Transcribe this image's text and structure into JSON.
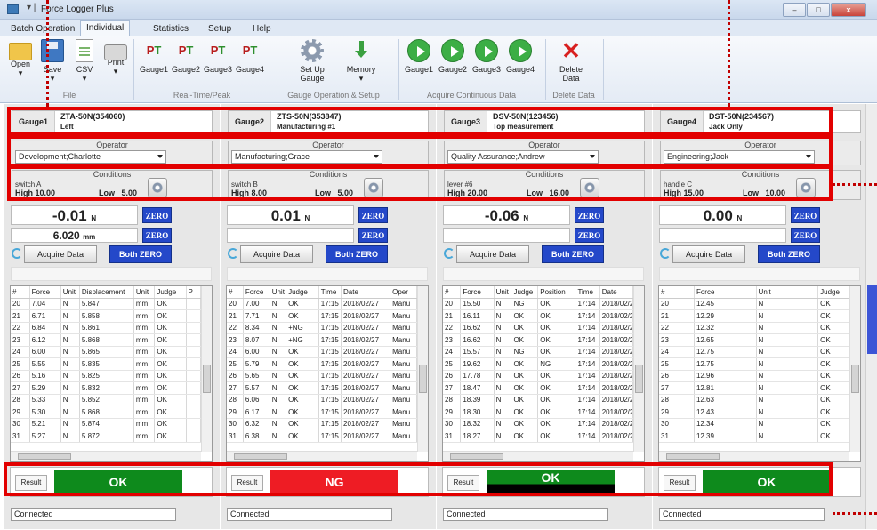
{
  "window": {
    "title": "Force Logger Plus",
    "quick_access": "▾ |"
  },
  "tabs": [
    "Batch Operation",
    "Individual",
    "Statistics",
    "Setup",
    "Help"
  ],
  "ribbon": {
    "buttons": [
      {
        "label": "Open",
        "sub": "▾"
      },
      {
        "label": "Save",
        "sub": "▾"
      },
      {
        "label": "CSV",
        "sub": "▾"
      },
      {
        "label": "Print",
        "sub": "▾"
      },
      {
        "label": "Gauge1"
      },
      {
        "label": "Gauge2"
      },
      {
        "label": "Gauge3"
      },
      {
        "label": "Gauge4"
      },
      {
        "label": "Set Up\nGauge",
        "sub": "▾"
      },
      {
        "label": "Memory",
        "sub": "▾"
      },
      {
        "label": "Gauge1"
      },
      {
        "label": "Gauge2"
      },
      {
        "label": "Gauge3"
      },
      {
        "label": "Gauge4"
      },
      {
        "label": "Delete\nData",
        "sub": "▾"
      }
    ],
    "groups": [
      "File",
      "Real-Time/Peak",
      "Gauge Operation & Setup",
      "Acquire Continuous Data",
      "Delete Data"
    ]
  },
  "labels": {
    "operator": "Operator",
    "conditions": "Conditions",
    "high": "High",
    "low": "Low",
    "zero": "ZERO",
    "acquire": "Acquire Data",
    "both_zero": "Both ZERO",
    "result": "Result"
  },
  "gauges": [
    {
      "name": "Gauge1",
      "model": "ZTA-50N(354060)",
      "sub": "Left",
      "operator": "Development;Charlotte",
      "cond_name": "switch A",
      "high": "10.00",
      "low": "5.00",
      "force": "-0.01",
      "force_unit": "N",
      "disp": "6.020",
      "disp_unit": "mm",
      "columns": [
        "#",
        "Force",
        "Unit",
        "Displacement",
        "Unit",
        "Judge",
        "P"
      ],
      "rows": [
        [
          "20",
          "7.04",
          "N",
          "5.847",
          "mm",
          "OK",
          ""
        ],
        [
          "21",
          "6.71",
          "N",
          "5.858",
          "mm",
          "OK",
          ""
        ],
        [
          "22",
          "6.84",
          "N",
          "5.861",
          "mm",
          "OK",
          ""
        ],
        [
          "23",
          "6.12",
          "N",
          "5.868",
          "mm",
          "OK",
          ""
        ],
        [
          "24",
          "6.00",
          "N",
          "5.865",
          "mm",
          "OK",
          ""
        ],
        [
          "25",
          "5.55",
          "N",
          "5.835",
          "mm",
          "OK",
          ""
        ],
        [
          "26",
          "5.16",
          "N",
          "5.825",
          "mm",
          "OK",
          ""
        ],
        [
          "27",
          "5.29",
          "N",
          "5.832",
          "mm",
          "OK",
          ""
        ],
        [
          "28",
          "5.33",
          "N",
          "5.852",
          "mm",
          "OK",
          ""
        ],
        [
          "29",
          "5.30",
          "N",
          "5.868",
          "mm",
          "OK",
          ""
        ],
        [
          "30",
          "5.21",
          "N",
          "5.874",
          "mm",
          "OK",
          ""
        ],
        [
          "31",
          "5.27",
          "N",
          "5.872",
          "mm",
          "OK",
          ""
        ]
      ],
      "result": "OK",
      "status": "Connected"
    },
    {
      "name": "Gauge2",
      "model": "ZTS-50N(353847)",
      "sub": "Manufacturing #1",
      "operator": "Manufacturing;Grace",
      "cond_name": "switch B",
      "high": "8.00",
      "low": "5.00",
      "force": "0.01",
      "force_unit": "N",
      "disp": "",
      "disp_unit": "",
      "columns": [
        "#",
        "Force",
        "Unit",
        "Judge",
        "Time",
        "Date",
        "Oper"
      ],
      "rows": [
        [
          "20",
          "7.00",
          "N",
          "OK",
          "17:15",
          "2018/02/27",
          "Manu"
        ],
        [
          "21",
          "7.71",
          "N",
          "OK",
          "17:15",
          "2018/02/27",
          "Manu"
        ],
        [
          "22",
          "8.34",
          "N",
          "+NG",
          "17:15",
          "2018/02/27",
          "Manu"
        ],
        [
          "23",
          "8.07",
          "N",
          "+NG",
          "17:15",
          "2018/02/27",
          "Manu"
        ],
        [
          "24",
          "6.00",
          "N",
          "OK",
          "17:15",
          "2018/02/27",
          "Manu"
        ],
        [
          "25",
          "5.79",
          "N",
          "OK",
          "17:15",
          "2018/02/27",
          "Manu"
        ],
        [
          "26",
          "5.65",
          "N",
          "OK",
          "17:15",
          "2018/02/27",
          "Manu"
        ],
        [
          "27",
          "5.57",
          "N",
          "OK",
          "17:15",
          "2018/02/27",
          "Manu"
        ],
        [
          "28",
          "6.06",
          "N",
          "OK",
          "17:15",
          "2018/02/27",
          "Manu"
        ],
        [
          "29",
          "6.17",
          "N",
          "OK",
          "17:15",
          "2018/02/27",
          "Manu"
        ],
        [
          "30",
          "6.32",
          "N",
          "OK",
          "17:15",
          "2018/02/27",
          "Manu"
        ],
        [
          "31",
          "6.38",
          "N",
          "OK",
          "17:15",
          "2018/02/27",
          "Manu"
        ]
      ],
      "result": "NG",
      "status": "Connected"
    },
    {
      "name": "Gauge3",
      "model": "DSV-50N(123456)",
      "sub": "Top measurement",
      "operator": "Quality Assurance;Andrew",
      "cond_name": "lever #6",
      "high": "20.00",
      "low": "16.00",
      "force": "-0.06",
      "force_unit": "N",
      "disp": "",
      "disp_unit": "",
      "columns": [
        "#",
        "Force",
        "Unit",
        "Judge",
        "Position",
        "Time",
        "Date"
      ],
      "rows": [
        [
          "20",
          "15.50",
          "N",
          "NG",
          "OK",
          "17:14",
          "2018/02/2"
        ],
        [
          "21",
          "16.11",
          "N",
          "OK",
          "OK",
          "17:14",
          "2018/02/2"
        ],
        [
          "22",
          "16.62",
          "N",
          "OK",
          "OK",
          "17:14",
          "2018/02/2"
        ],
        [
          "23",
          "16.62",
          "N",
          "OK",
          "OK",
          "17:14",
          "2018/02/2"
        ],
        [
          "24",
          "15.57",
          "N",
          "NG",
          "OK",
          "17:14",
          "2018/02/2"
        ],
        [
          "25",
          "19.62",
          "N",
          "OK",
          "NG",
          "17:14",
          "2018/02/2"
        ],
        [
          "26",
          "17.78",
          "N",
          "OK",
          "OK",
          "17:14",
          "2018/02/2"
        ],
        [
          "27",
          "18.47",
          "N",
          "OK",
          "OK",
          "17:14",
          "2018/02/2"
        ],
        [
          "28",
          "18.39",
          "N",
          "OK",
          "OK",
          "17:14",
          "2018/02/2"
        ],
        [
          "29",
          "18.30",
          "N",
          "OK",
          "OK",
          "17:14",
          "2018/02/2"
        ],
        [
          "30",
          "18.32",
          "N",
          "OK",
          "OK",
          "17:14",
          "2018/02/2"
        ],
        [
          "31",
          "18.27",
          "N",
          "OK",
          "OK",
          "17:14",
          "2018/02/2"
        ]
      ],
      "result": "OK",
      "status": "Connected"
    },
    {
      "name": "Gauge4",
      "model": "DST-50N(234567)",
      "sub": "Jack Only",
      "operator": "Engineering;Jack",
      "cond_name": "handle C",
      "high": "15.00",
      "low": "10.00",
      "force": "0.00",
      "force_unit": "N",
      "disp": "",
      "disp_unit": "",
      "columns": [
        "#",
        "Force",
        "Unit",
        "Judge"
      ],
      "rows": [
        [
          "20",
          "12.45",
          "N",
          "OK"
        ],
        [
          "21",
          "12.29",
          "N",
          "OK"
        ],
        [
          "22",
          "12.32",
          "N",
          "OK"
        ],
        [
          "23",
          "12.65",
          "N",
          "OK"
        ],
        [
          "24",
          "12.75",
          "N",
          "OK"
        ],
        [
          "25",
          "12.75",
          "N",
          "OK"
        ],
        [
          "26",
          "12.96",
          "N",
          "OK"
        ],
        [
          "27",
          "12.81",
          "N",
          "OK"
        ],
        [
          "28",
          "12.63",
          "N",
          "OK"
        ],
        [
          "29",
          "12.43",
          "N",
          "OK"
        ],
        [
          "30",
          "12.34",
          "N",
          "OK"
        ],
        [
          "31",
          "12.39",
          "N",
          "OK"
        ]
      ],
      "result": "OK",
      "status": "Connected"
    }
  ],
  "colors": {
    "ok": "#0e8a1c",
    "ng": "#ee1c24",
    "blue_button": "#2448c9",
    "highlight": "#e20000"
  }
}
